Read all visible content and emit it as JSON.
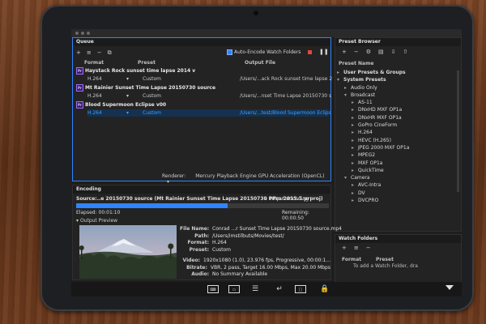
{
  "queue": {
    "title": "Queue",
    "auto_encode_label": "Auto-Encode Watch Folders",
    "columns": {
      "format": "Format",
      "preset": "Preset",
      "output": "Output File"
    },
    "items": [
      {
        "name": "Haystack Rock sunset time lapse 2014 v",
        "format": "H.264",
        "preset": "Custom",
        "output": "/Users/...ack Rock sunset time lapse 2",
        "selected": false
      },
      {
        "name": "Mt Rainier Sunset Time Lapse 20150730 source",
        "format": "H.264",
        "preset": "Custom",
        "output": "/Users/...nset Time Lapse 20150730 s",
        "selected": false
      },
      {
        "name": "Blood Supermoon Eclipse v00",
        "format": "H.264",
        "preset": "Custom",
        "output": "/Users/...test/Blood Supermoon Eclips",
        "selected": true
      }
    ],
    "renderer_label": "Renderer:",
    "renderer_value": "Mercury Playback Engine GPU Acceleration (OpenCL)"
  },
  "preset_browser": {
    "title": "Preset Browser",
    "column": "Preset Name",
    "tree": [
      {
        "label": "User Presets & Groups",
        "level": 0,
        "tri": "▸",
        "bold": true
      },
      {
        "label": "System Presets",
        "level": 0,
        "tri": "▾",
        "bold": true
      },
      {
        "label": "Audio Only",
        "level": 1,
        "tri": "▸",
        "bold": false
      },
      {
        "label": "Broadcast",
        "level": 1,
        "tri": "▾",
        "bold": false
      },
      {
        "label": "AS-11",
        "level": 2,
        "tri": "▸",
        "bold": false
      },
      {
        "label": "DNxHD MXF OP1a",
        "level": 2,
        "tri": "▸",
        "bold": false
      },
      {
        "label": "DNxHR MXF OP1a",
        "level": 2,
        "tri": "▸",
        "bold": false
      },
      {
        "label": "GoPro CineForm",
        "level": 2,
        "tri": "▸",
        "bold": false
      },
      {
        "label": "H.264",
        "level": 2,
        "tri": "▸",
        "bold": false
      },
      {
        "label": "HEVC (H.265)",
        "level": 2,
        "tri": "▸",
        "bold": false
      },
      {
        "label": "JPEG 2000 MXF OP1a",
        "level": 2,
        "tri": "▸",
        "bold": false
      },
      {
        "label": "MPEG2",
        "level": 2,
        "tri": "▸",
        "bold": false
      },
      {
        "label": "MXF OP1a",
        "level": 2,
        "tri": "▸",
        "bold": false
      },
      {
        "label": "QuickTime",
        "level": 2,
        "tri": "▸",
        "bold": false
      },
      {
        "label": "Camera",
        "level": 1,
        "tri": "▾",
        "bold": false
      },
      {
        "label": "AVC-Intra",
        "level": 2,
        "tri": "▸",
        "bold": false
      },
      {
        "label": "DV",
        "level": 2,
        "tri": "▸",
        "bold": false
      },
      {
        "label": "DVCPRO",
        "level": 2,
        "tri": "▸",
        "bold": false
      }
    ]
  },
  "watch_folders": {
    "title": "Watch Folders",
    "columns": {
      "format": "Format",
      "preset": "Preset"
    },
    "hint": "To add a Watch Folder, dra"
  },
  "encoding": {
    "title": "Encoding",
    "source": "Source:..e 20150730 source (Mt Rainier Sunset Time Lapse 20150730 PPro 2015.1.prproj)",
    "output_count": "1 output encoding",
    "progress": 0.6,
    "elapsed": "Elapsed: 00:01:10",
    "remaining": "Remaining: 00:00:50",
    "output_preview_label": "Output Preview",
    "file_info": [
      {
        "k": "File Name:",
        "v": "Conrad ...r Sunset Time Lapse 20150730 source.mp4"
      },
      {
        "k": "Path:",
        "v": "/Users/imstilbuts/Movies/test/"
      },
      {
        "k": "Format:",
        "v": "H.264"
      },
      {
        "k": "Preset:",
        "v": "Custom"
      },
      {
        "k": "Video:",
        "v": "1920x1080 (1.0), 23.976 fps, Progressive, 00:00:1..."
      },
      {
        "k": "Bitrate:",
        "v": "VBR, 2 pass, Target 16.00 Mbps, Max 20.00 Mbps"
      },
      {
        "k": "Audio:",
        "v": "No Summary Available"
      }
    ]
  },
  "colors": {
    "accent": "#2f84ff",
    "stop": "#e5483a",
    "panel": "#232323"
  }
}
